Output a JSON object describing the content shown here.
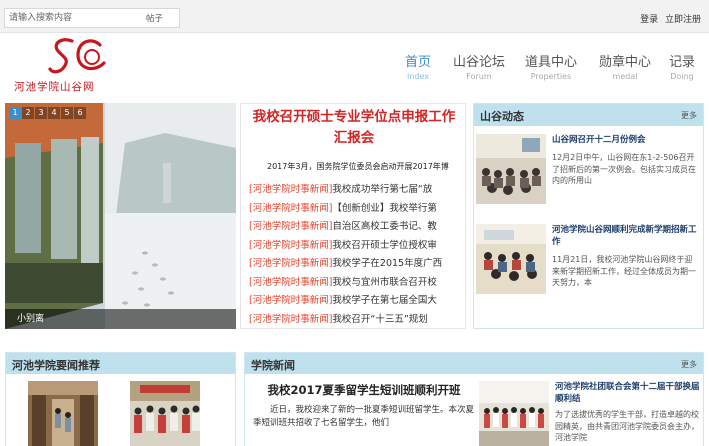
{
  "topbar": {
    "search_placeholder": "请输入搜索内容",
    "search_type": "帖子",
    "login": "登录",
    "register": "立即注册"
  },
  "logo": {
    "text": "河池学院山谷网"
  },
  "nav": [
    {
      "cn": "首页",
      "en": "Index"
    },
    {
      "cn": "山谷论坛",
      "en": "Forum"
    },
    {
      "cn": "道具中心",
      "en": "Properties"
    },
    {
      "cn": "勋章中心",
      "en": "medal"
    },
    {
      "cn": "记录",
      "en": "Doing"
    }
  ],
  "slider": {
    "numbers": [
      "1",
      "2",
      "3",
      "4",
      "5",
      "6"
    ],
    "caption": "小别离"
  },
  "headline": {
    "title": "我校召开硕士专业学位点申报工作汇报会",
    "subtitle": "2017年3月，国务院学位委员会启动开展2017年博",
    "items": [
      {
        "tag": "[河池学院时事新闻]",
        "text": "我校成功举行第七届“放"
      },
      {
        "tag": "[河池学院时事新闻]",
        "text": "【创新创业】我校举行第"
      },
      {
        "tag": "[河池学院时事新闻]",
        "text": "自治区高校工委书记、教"
      },
      {
        "tag": "[河池学院时事新闻]",
        "text": "我校召开硕士学位授权审"
      },
      {
        "tag": "[河池学院时事新闻]",
        "text": "我校学子在2015年度广西"
      },
      {
        "tag": "[河池学院时事新闻]",
        "text": "我校与宜州市联合召开校"
      },
      {
        "tag": "[河池学院时事新闻]",
        "text": "我校学子在第七届全国大"
      },
      {
        "tag": "[河池学院时事新闻]",
        "text": "我校召开“十三五”规划"
      }
    ]
  },
  "valley": {
    "title": "山谷动态",
    "more": "更多",
    "items": [
      {
        "title": "山谷网召开十二月份例会",
        "body": "12月2日中午，山谷网在东1-2-506召开了招新后的第一次例会。包括实习成员在内的所用山"
      },
      {
        "title": "河池学院山谷网顺利完成新学期招新工作",
        "body": "11月21日，我校河池学院山谷网终于迎来新学期招新工作，经过全体成员为期一天努力，本"
      }
    ]
  },
  "important": {
    "title": "河池学院要闻推荐"
  },
  "news": {
    "title": "学院新闻",
    "more": "更多",
    "headline": "我校2017夏季留学生短训班顺利开班",
    "body": "近日，我校迎来了新的一批夏季短训班留学生。本次夏季短训班共招收了七名留学生，他们",
    "item_title": "河池学院社团联合会第十二届干部换届顺利结",
    "item_body": "为了选拔优秀的学生干部，打造卓越的校园精英，由共青团河池学院委员会主办，河池学院"
  }
}
